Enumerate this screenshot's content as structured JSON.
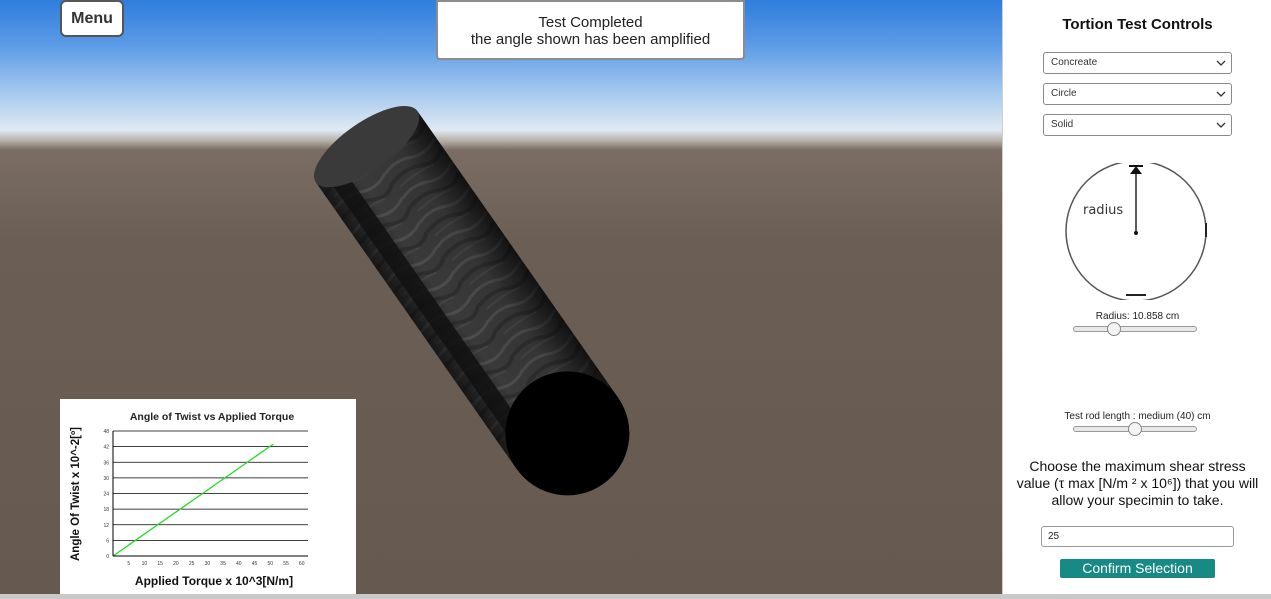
{
  "menu": {
    "label": "Menu"
  },
  "status": {
    "line1": "Test Completed",
    "line2": "the angle shown has been amplified"
  },
  "controls": {
    "title": "Tortion Test Controls",
    "material": "Concreate",
    "shape": "Circle",
    "fill": "Solid",
    "diagram_label": "radius",
    "radius_label": "Radius: 10.858 cm",
    "radius_level": 0.31,
    "length_label": "Test rod length : medium (40) cm",
    "length_level": 0.5,
    "question": "Choose the maximum shear stress value (τ max [N/m ² x 10⁶]) that you will allow your specimin to take.",
    "stress_value": "25",
    "confirm_label": "Confirm Selection"
  },
  "chart_data": {
    "type": "line",
    "title": "Angle of Twist vs Applied Torque",
    "xlabel": "Applied Torque x 10^3[N/m]",
    "ylabel": "Angle Of Twist x 10^-2[º]",
    "x_ticks": [
      5,
      10,
      15,
      20,
      25,
      30,
      35,
      40,
      45,
      50,
      55,
      60
    ],
    "y_ticks": [
      0,
      6,
      12,
      18,
      24,
      30,
      36,
      42,
      48
    ],
    "xlim": [
      0,
      62
    ],
    "ylim": [
      0,
      48
    ],
    "grid": true,
    "series": [
      {
        "color": "#22dd22",
        "x": [
          0,
          51
        ],
        "y": [
          0,
          43
        ]
      }
    ]
  }
}
